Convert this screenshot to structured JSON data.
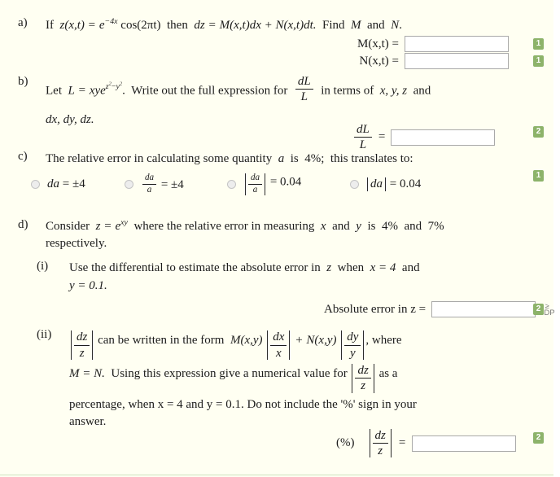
{
  "page": {
    "background": "#fffff2",
    "mark_badge_color": "#8db36a",
    "input_border_color": "#a9a9a9",
    "rule_color": "#cfe3c0"
  },
  "questions": {
    "a": {
      "label": "a)",
      "text_if": "If",
      "text_then": "then",
      "text_find": "Find",
      "text_and": "and",
      "z_of": "z(x,t)",
      "eq": "=",
      "e_base": "e",
      "e_exp": "−4x",
      "cos": "cos(2πt)",
      "dz": "dz",
      "rhs": "M(x,t)dx + N(x,t)dt.",
      "find_M": "M",
      "find_N": "N",
      "period": ".",
      "answers": [
        {
          "label": "M(x,t) =",
          "value": "",
          "placeholder": "",
          "mark": "1"
        },
        {
          "label": "N(x,t) =",
          "value": "",
          "placeholder": "",
          "mark": "1"
        }
      ]
    },
    "b": {
      "label": "b)",
      "text_let": "Let",
      "L": "L",
      "eq": "=",
      "expr": "xye",
      "exp_z": "z",
      "exp_sup2a": "2",
      "exp_minus": "−",
      "exp_y": "y",
      "exp_sup2b": "2",
      "period": ".",
      "text_write": "Write out the full expression for",
      "frac_num": "dL",
      "frac_den": "L",
      "text_interms": "in terms of",
      "vars1": "x, y, z",
      "text_and": "and",
      "vars2": "dx, dy, dz.",
      "answer": {
        "num": "dL",
        "den": "L",
        "eq": "=",
        "value": "",
        "placeholder": "",
        "mark": "2"
      }
    },
    "c": {
      "label": "c)",
      "text_part1": "The relative error in calculating some quantity",
      "quantity": "a",
      "text_is": "is",
      "percent": "4%;",
      "text_part2": "this translates to:",
      "mark": "1",
      "options": [
        {
          "name": "option-da-pm4",
          "kind": "plain",
          "left": "da",
          "eq": "= ±4",
          "selected": false
        },
        {
          "name": "option-da-over-a-pm4",
          "kind": "frac",
          "num": "da",
          "den": "a",
          "eq": "= ±4",
          "selected": false
        },
        {
          "name": "option-abs-da-over-a-004",
          "kind": "absfrac",
          "num": "da",
          "den": "a",
          "eq": "= 0.04",
          "selected": false
        },
        {
          "name": "option-abs-da-004",
          "kind": "abs",
          "inner": "da",
          "eq": "= 0.04",
          "selected": false
        }
      ]
    },
    "d": {
      "label": "d)",
      "intro_1": "Consider",
      "z": "z",
      "eq": "=",
      "e": "e",
      "e_exp": "xy",
      "intro_2": "where the relative error in measuring",
      "x": "x",
      "and": "and",
      "y": "y",
      "is": "is",
      "p1": "4%",
      "and2": "and",
      "p2": "7%",
      "intro_3": "respectively.",
      "parts": {
        "i": {
          "label": "(i)",
          "line1_a": "Use the differential to estimate the absolute error in",
          "line1_z": "z",
          "line1_b": "when",
          "line1_x": "x = 4",
          "line1_and": "and",
          "line2": "y = 0.1.",
          "answer": {
            "label": "Absolute error in z =",
            "value": "",
            "placeholder": "",
            "dp_geq": "≥",
            "dp_text": "3DP",
            "mark": "2"
          }
        },
        "ii": {
          "label": "(ii)",
          "abs1_num": "dz",
          "abs1_den": "z",
          "t1": "can be written in the form",
          "M": "M(x,y)",
          "abs2_num": "dx",
          "abs2_den": "x",
          "plus": "+",
          "N": "N(x,y)",
          "abs3_num": "dy",
          "abs3_den": "y",
          "t2": ", where",
          "line2_a": "M = N.",
          "line2_b": "Using this expression give a numerical value for",
          "abs4_num": "dz",
          "abs4_den": "z",
          "line2_c": "as a",
          "line3": "percentage, when  x = 4  and  y = 0.1.  Do not include the '%' sign in your",
          "line4": "answer.",
          "answer": {
            "pct": "(%)",
            "num": "dz",
            "den": "z",
            "eq": "=",
            "value": "",
            "placeholder": "",
            "mark": "2"
          }
        }
      }
    }
  }
}
